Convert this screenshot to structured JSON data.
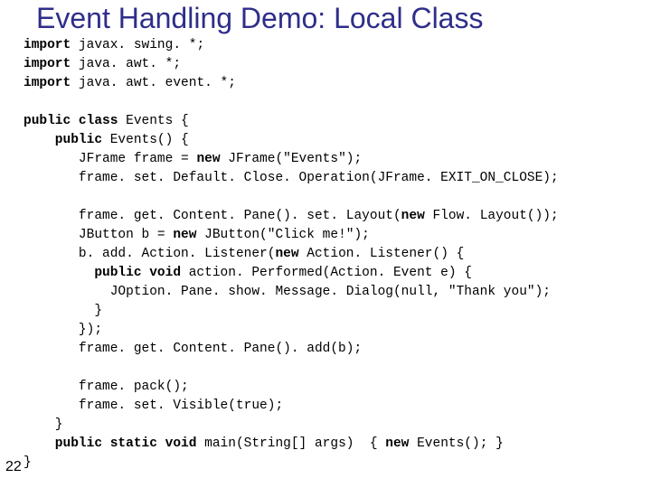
{
  "title": "Event Handling Demo: Local Class",
  "page_number": "22",
  "code": {
    "l01a": "import",
    "l01b": " javax. swing. *;",
    "l02a": "import",
    "l02b": " java. awt. *;",
    "l03a": "import",
    "l03b": " java. awt. event. *;",
    "l04": "",
    "l05a": "public class",
    "l05b": " Events {",
    "l06a": "    public",
    "l06b": " Events() {",
    "l07a": "       JFrame frame = ",
    "l07b": "new",
    "l07c": " JFrame(\"Events\");",
    "l08": "       frame. set. Default. Close. Operation(JFrame. EXIT_ON_CLOSE);",
    "l09": "",
    "l10a": "       frame. get. Content. Pane(). set. Layout(",
    "l10b": "new",
    "l10c": " Flow. Layout());",
    "l11a": "       JButton b = ",
    "l11b": "new",
    "l11c": " JButton(\"Click me!\");",
    "l12a": "       b. add. Action. Listener(",
    "l12b": "new",
    "l12c": " Action. Listener() {",
    "l13a": "         public void",
    "l13b": " action. Performed(Action. Event e) {",
    "l14": "           JOption. Pane. show. Message. Dialog(null, \"Thank you\");",
    "l15": "         }",
    "l16": "       });",
    "l17": "       frame. get. Content. Pane(). add(b);",
    "l18": "",
    "l19": "       frame. pack();",
    "l20": "       frame. set. Visible(true);",
    "l21": "    }",
    "l22a": "    public static void",
    "l22b": " main(String[] args)  { ",
    "l22c": "new",
    "l22d": " Events(); }",
    "l23": "}"
  }
}
